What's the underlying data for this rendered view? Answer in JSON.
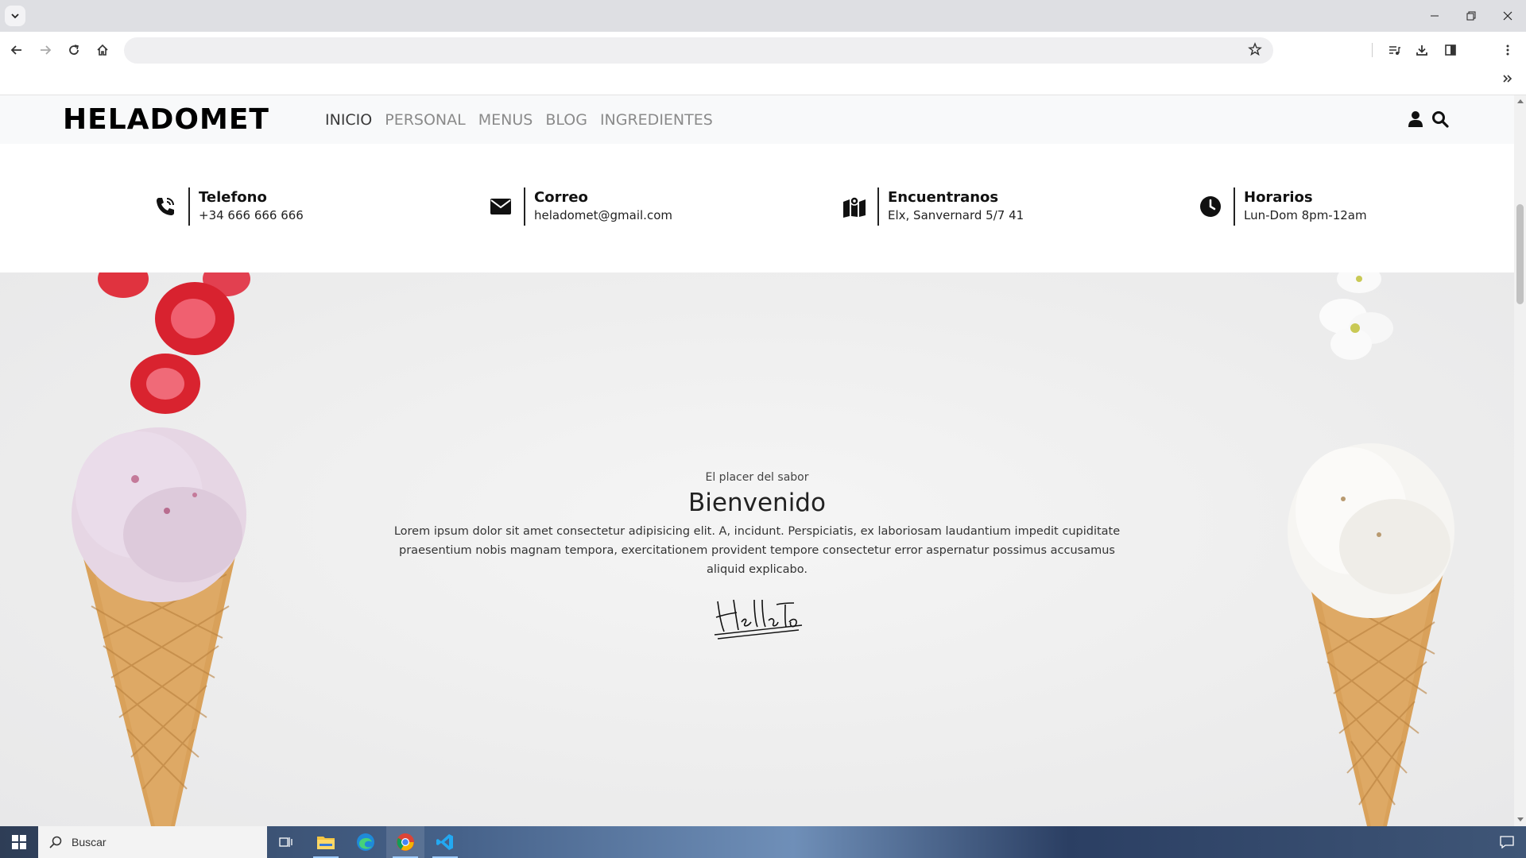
{
  "browser": {
    "tab_menu_icon": "chevron-down-icon",
    "window_controls": [
      "minimize-icon",
      "restore-icon",
      "close-icon"
    ],
    "omnibox": {
      "value": "",
      "placeholder": ""
    },
    "colors": {
      "chrome_bg": "#dedfe3",
      "omnibox_bg": "#efeff1"
    }
  },
  "site": {
    "logo": "HELADOMET",
    "nav": [
      "INICIO",
      "PERSONAL",
      "MENUS",
      "BLOG",
      "INGREDIENTES"
    ],
    "active_nav": "INICIO",
    "header_icons": [
      "user-icon",
      "search-icon"
    ],
    "info": [
      {
        "icon": "phone-icon",
        "title": "Telefono",
        "value": "+34 666 666 666"
      },
      {
        "icon": "envelope-icon",
        "title": "Correo",
        "value": "heladomet@gmail.com"
      },
      {
        "icon": "map-icon",
        "title": "Encuentranos",
        "value": "Elx, Sanvernard 5/7 41"
      },
      {
        "icon": "clock-icon",
        "title": "Horarios",
        "value": "Lun-Dom 8pm-12am"
      }
    ],
    "hero": {
      "kicker": "El placer del sabor",
      "title": "Bienvenido",
      "body": "Lorem ipsum dolor sit amet consectetur adipisicing elit. A, incidunt. Perspiciatis, ex laboriosam laudantium impedit cupiditate praesentium nobis magnam tempora, exercitationem provident tempore consectetur error aspernatur possimus accusamus aliquid explicabo.",
      "signature": "HellaTo"
    }
  },
  "taskbar": {
    "search_placeholder": "Buscar",
    "apps": [
      "task-view-icon",
      "file-explorer-icon",
      "edge-icon",
      "chrome-icon",
      "vscode-icon"
    ],
    "active_app": "chrome-icon"
  }
}
